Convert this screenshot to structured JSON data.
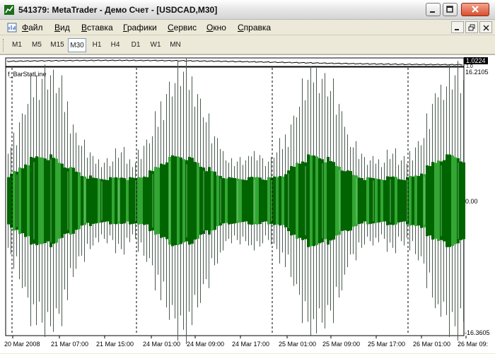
{
  "window": {
    "title": "541379: MetaTrader - Демо Счет - [USDCAD,M30]"
  },
  "menu": {
    "items": [
      "Файл",
      "Вид",
      "Вставка",
      "Графики",
      "Сервис",
      "Окно",
      "Справка"
    ]
  },
  "timeframes": {
    "items": [
      "M1",
      "M5",
      "M15",
      "M30",
      "H1",
      "H4",
      "D1",
      "W1",
      "MN"
    ],
    "active": "M30"
  },
  "price_pane": {
    "current_price": "1.0224",
    "second_label": "1.0"
  },
  "colors": {
    "bar_dark": "#006400",
    "bar_light": "#33a633",
    "bar_grey": "#4a5a50",
    "separator": "#000000",
    "price_label_bg": "#000000",
    "price_label_text": "#ffffff"
  },
  "chart_data": {
    "type": "bar",
    "title": "f_BarStatLine",
    "y_axis": {
      "max_label": "16.2105",
      "zero_label": "0.00",
      "min_label": "-16.3605",
      "ylim": [
        -16.3605,
        16.2105
      ]
    },
    "x_labels": [
      "20 Mar 2008",
      "21 Mar 07:00",
      "21 Mar 15:00",
      "24 Mar 01:00",
      "24 Mar 09:00",
      "24 Mar 17:00",
      "25 Mar 01:00",
      "25 Mar 09:00",
      "25 Mar 17:00",
      "26 Mar 01:00",
      "26 Mar 09:"
    ],
    "series": [
      {
        "name": "range",
        "description": "grey high-low lines, envelope repeats per trading day",
        "cycle_amplitude": [
          5,
          5,
          6,
          7,
          8,
          10,
          12,
          14,
          15,
          16,
          16,
          15,
          14,
          12,
          10,
          8,
          7,
          6,
          5,
          5,
          5,
          5,
          6,
          6
        ]
      },
      {
        "name": "body",
        "description": "green filled blocks",
        "cycle_amplitude": [
          2.8,
          2.8,
          3.0,
          3.2,
          3.6,
          4.2,
          4.8,
          5.2,
          5.5,
          5.6,
          5.5,
          5.2,
          4.8,
          4.4,
          4.0,
          3.6,
          3.2,
          3.0,
          2.8,
          2.8,
          2.8,
          2.8,
          2.9,
          3.0
        ]
      }
    ],
    "grid": false
  }
}
